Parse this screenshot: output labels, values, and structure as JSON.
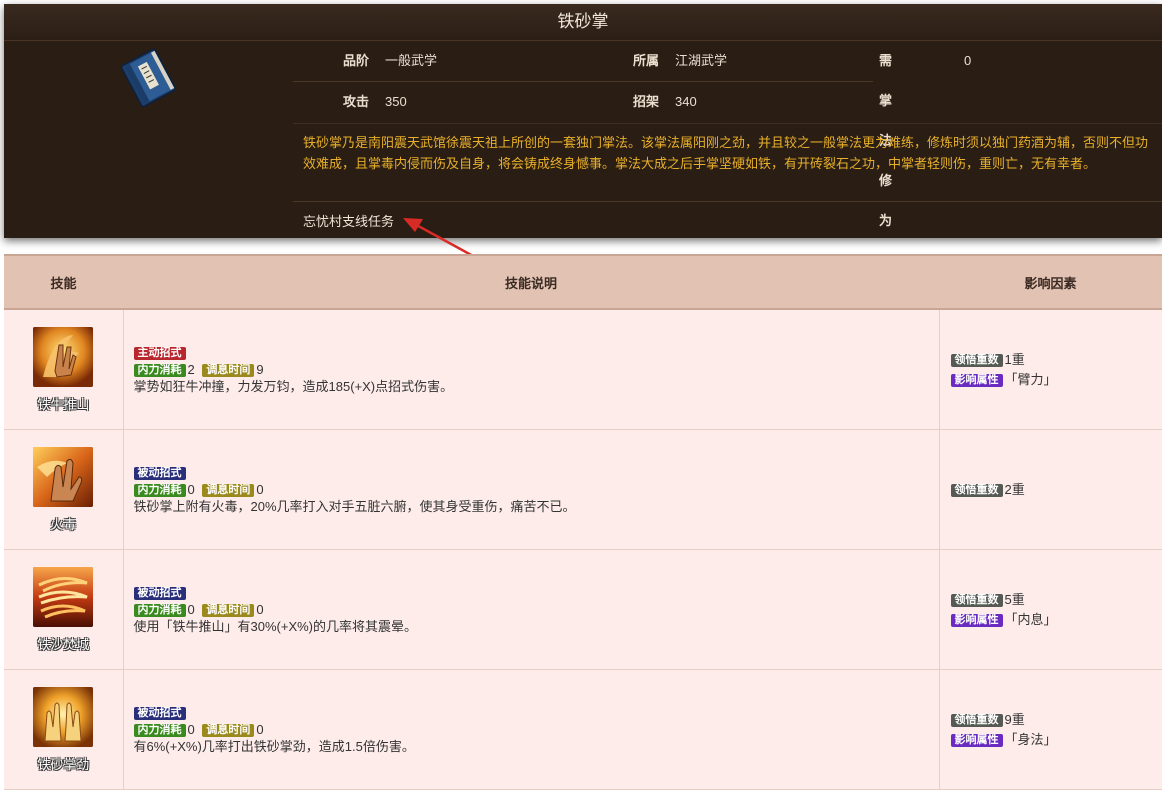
{
  "book": {
    "title": "铁砂掌",
    "icon": "blue-book-icon",
    "stats": {
      "grade_label": "品阶",
      "grade_value": "一般武学",
      "school_label": "所属",
      "school_value": "江湖武学",
      "req_label": "需掌法修为",
      "req_value": "0",
      "attack_label": "攻击",
      "attack_value": "350",
      "parry_label": "招架",
      "parry_value": "340"
    },
    "description": "铁砂掌乃是南阳震天武馆徐震天祖上所创的一套独门掌法。该掌法属阳刚之劲，并且较之一般掌法更为难练，修炼时须以独门药酒为辅，否则不但功效难成，且掌毒内侵而伤及自身，将会铸成终身憾事。掌法大成之后手掌坚硬如铁，有开砖裂石之功，中掌者轻则伤，重则亡，无有幸者。",
    "source": "忘忧村支线任务"
  },
  "table": {
    "headers": {
      "skill": "技能",
      "desc": "技能说明",
      "factors": "影响因素"
    },
    "rows": [
      {
        "name": "铁牛推山",
        "icon": "palm-push-fire-icon",
        "type_tag": "主动招式",
        "type_color": "#b8272e",
        "mp_label": "内力消耗",
        "mp_value": "2",
        "cd_label": "调息时间",
        "cd_value": "9",
        "text": "掌势如狂牛冲撞，力发万钧，造成185(+X)点招式伤害。",
        "level_label": "领悟重数",
        "level_value": "1重",
        "attr_label": "影响属性",
        "attr_value": "「臂力」"
      },
      {
        "name": "火毒",
        "icon": "palm-fire-poison-icon",
        "type_tag": "被动招式",
        "type_color": "#2a2f7a",
        "mp_label": "内力消耗",
        "mp_value": "0",
        "cd_label": "调息时间",
        "cd_value": "0",
        "text": "铁砂掌上附有火毒，20%几率打入对手五脏六腑，使其身受重伤，痛苦不已。",
        "level_label": "领悟重数",
        "level_value": "2重",
        "attr_label": "",
        "attr_value": ""
      },
      {
        "name": "铁沙焚城",
        "icon": "fire-vortex-icon",
        "type_tag": "被动招式",
        "type_color": "#2a2f7a",
        "mp_label": "内力消耗",
        "mp_value": "0",
        "cd_label": "调息时间",
        "cd_value": "0",
        "text": "使用「铁牛推山」有30%(+X%)的几率将其震晕。",
        "level_label": "领悟重数",
        "level_value": "5重",
        "attr_label": "影响属性",
        "attr_value": "「内息」"
      },
      {
        "name": "铁砂掌劲",
        "icon": "glowing-palms-icon",
        "type_tag": "被动招式",
        "type_color": "#2a2f7a",
        "mp_label": "内力消耗",
        "mp_value": "0",
        "cd_label": "调息时间",
        "cd_value": "0",
        "text": "有6%(+X%)几率打出铁砂掌劲，造成1.5倍伤害。",
        "level_label": "领悟重数",
        "level_value": "9重",
        "attr_label": "影响属性",
        "attr_value": "「身法」"
      }
    ]
  }
}
